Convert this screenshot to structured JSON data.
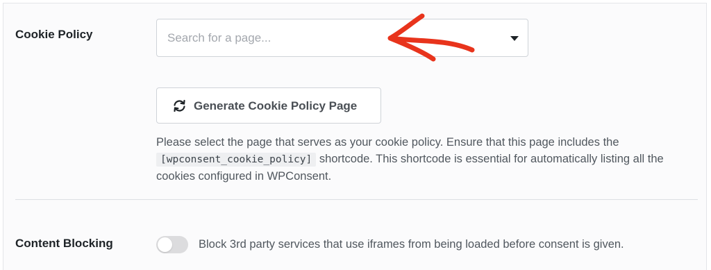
{
  "cookie_policy": {
    "label": "Cookie Policy",
    "select": {
      "placeholder": "Search for a page..."
    },
    "generate_button_label": "Generate Cookie Policy Page",
    "description": {
      "before_code": "Please select the page that serves as your cookie policy. Ensure that this page includes the ",
      "code": "[wpconsent_cookie_policy]",
      "after_code": " shortcode. This shortcode is essential for automatically listing all the cookies configured in WPConsent."
    }
  },
  "content_blocking": {
    "label": "Content Blocking",
    "toggle_on": false,
    "toggle_text": "Block 3rd party services that use iframes from being loaded before consent is given."
  },
  "colors": {
    "annotation_arrow": "#e8341c",
    "toggle_off": "#dcdcde"
  },
  "icons": {
    "annotation": "annotation-arrow-icon",
    "generate": "refresh-icon",
    "select_caret": "caret-down-icon"
  }
}
